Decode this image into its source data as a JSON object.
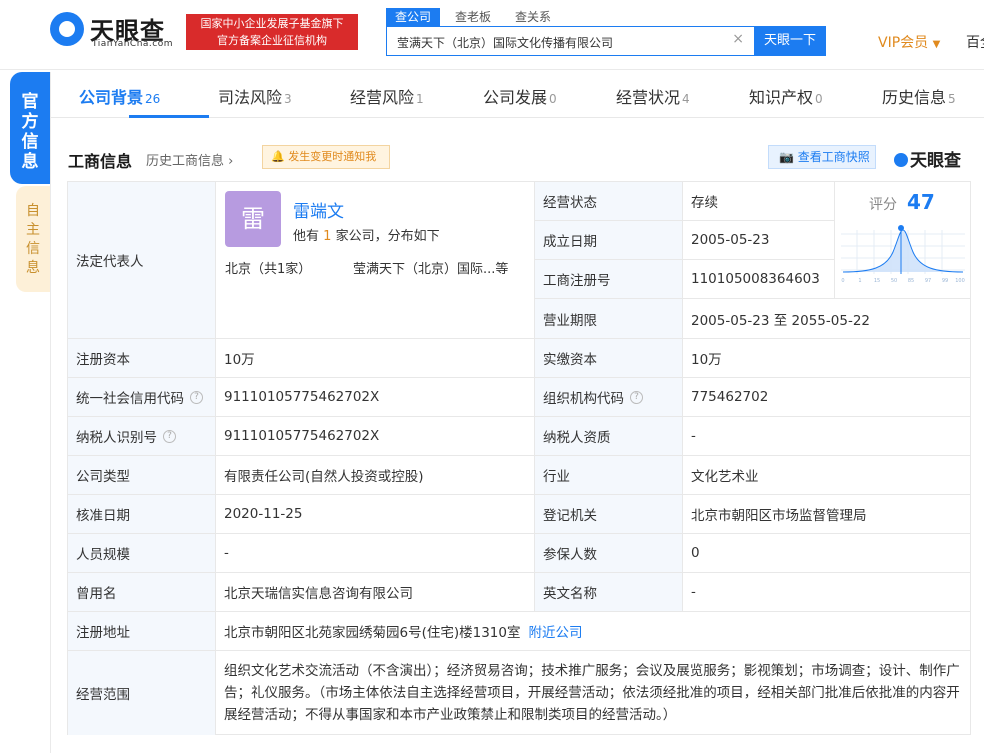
{
  "header": {
    "logo_text": "天眼查",
    "logo_sub": "TianYanCha.com",
    "gov_badge_line1": "国家中小企业发展子基金旗下",
    "gov_badge_line2": "官方备案企业征信机构",
    "search_tabs": [
      "查公司",
      "查老板",
      "查关系"
    ],
    "search_value": "莹满天下（北京）国际文化传播有限公司",
    "search_button": "天眼一下",
    "vip": "VIP会员",
    "more": "百全"
  },
  "side": {
    "official": "官方信息",
    "self": "自主信息"
  },
  "nav": {
    "tabs": [
      {
        "label": "公司背景",
        "count": "26"
      },
      {
        "label": "司法风险",
        "count": "3"
      },
      {
        "label": "经营风险",
        "count": "1"
      },
      {
        "label": "公司发展",
        "count": "0"
      },
      {
        "label": "经营状况",
        "count": "4"
      },
      {
        "label": "知识产权",
        "count": "0"
      },
      {
        "label": "历史信息",
        "count": "5"
      }
    ]
  },
  "section": {
    "title": "工商信息",
    "history": "历史工商信息",
    "notify": "发生变更时通知我",
    "snapshot": "查看工商快照",
    "watermark": "天眼查"
  },
  "legal_rep": {
    "label": "法定代表人",
    "avatar_char": "雷",
    "name": "雷端文",
    "desc_prefix": "他有",
    "desc_count": "1",
    "desc_suffix": "家公司，分布如下",
    "location": "北京（共1家）",
    "company": "莹满天下（北京）国际...等"
  },
  "score": {
    "label": "评分",
    "value": "47",
    "ticks": [
      "0",
      "1",
      "15",
      "50",
      "85",
      "97",
      "99",
      "100"
    ]
  },
  "rows": {
    "status_label": "经营状态",
    "status": "存续",
    "founded_label": "成立日期",
    "founded": "2005-05-23",
    "reg_no_label": "工商注册号",
    "reg_no": "110105008364603",
    "term_label": "营业期限",
    "term": "2005-05-23  至 2055-05-22",
    "capital_label": "注册资本",
    "capital": "10万",
    "paid_label": "实缴资本",
    "paid": "10万",
    "credit_label": "统一社会信用代码",
    "credit": "91110105775462702X",
    "org_label": "组织机构代码",
    "org": "775462702",
    "tax_label": "纳税人识别号",
    "tax": "91110105775462702X",
    "tax_q_label": "纳税人资质",
    "tax_q": "-",
    "type_label": "公司类型",
    "type": "有限责任公司(自然人投资或控股)",
    "industry_label": "行业",
    "industry": "文化艺术业",
    "approve_label": "核准日期",
    "approve": "2020-11-25",
    "authority_label": "登记机关",
    "authority": "北京市朝阳区市场监督管理局",
    "staff_label": "人员规模",
    "staff": "-",
    "insured_label": "参保人数",
    "insured": "0",
    "former_label": "曾用名",
    "former": "北京天瑞信实信息咨询有限公司",
    "english_label": "英文名称",
    "english": "-",
    "address_label": "注册地址",
    "address": "北京市朝阳区北苑家园绣菊园6号(住宅)楼1310室",
    "address_link": "附近公司",
    "scope_label": "经营范围",
    "scope": "组织文化艺术交流活动（不含演出）；经济贸易咨询；技术推广服务；会议及展览服务；影视策划；市场调查；设计、制作广告；礼仪服务。（市场主体依法自主选择经营项目，开展经营活动；依法须经批准的项目，经相关部门批准后依批准的内容开展经营活动；不得从事国家和本市产业政策禁止和限制类项目的经营活动。）"
  }
}
